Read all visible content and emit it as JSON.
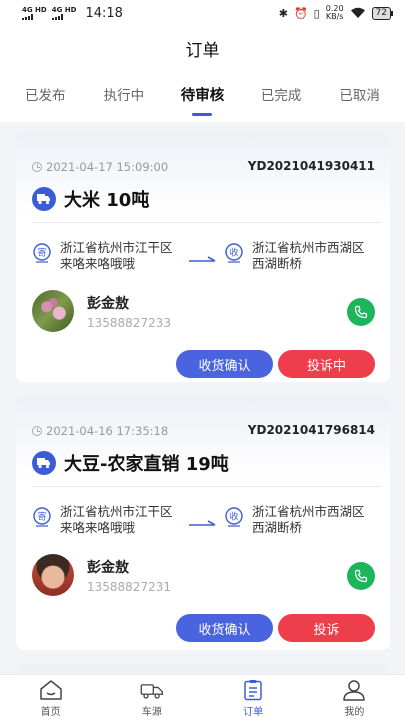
{
  "status_bar": {
    "net1": "4G HD",
    "net2": "4G HD",
    "time": "14:18",
    "speed_value": "0.20",
    "speed_unit": "KB/s",
    "battery": "72"
  },
  "header": {
    "title": "订单",
    "tabs": [
      "已发布",
      "执行中",
      "待审核",
      "已完成",
      "已取消"
    ],
    "active_tab": "待审核"
  },
  "orders": [
    {
      "date": "2021-04-17 15:09:00",
      "order_no": "YD2021041930411",
      "goods": "大米 10吨",
      "from_line1": "浙江省杭州市江干区",
      "from_line2": "来咯来咯哦哦",
      "to_line1": "浙江省杭州市西湖区",
      "to_line2": "西湖断桥",
      "contact_name": "彭金敖",
      "contact_phone": "13588827233",
      "confirm_label": "收货确认",
      "complaint_label": "投诉中"
    },
    {
      "date": "2021-04-16 17:35:18",
      "order_no": "YD2021041796814",
      "goods": "大豆-农家直销 19吨",
      "from_line1": "浙江省杭州市江干区",
      "from_line2": "来咯来咯哦哦",
      "to_line1": "浙江省杭州市西湖区",
      "to_line2": "西湖断桥",
      "contact_name": "彭金敖",
      "contact_phone": "13588827231",
      "confirm_label": "收货确认",
      "complaint_label": "投诉"
    }
  ],
  "tabbar": {
    "items": [
      "首页",
      "车源",
      "订单",
      "我的"
    ],
    "active": "订单"
  },
  "colors": {
    "accent": "#3c5bd9",
    "confirm": "#4a63df",
    "complaint": "#ee3e4b",
    "call": "#1cb55a"
  }
}
